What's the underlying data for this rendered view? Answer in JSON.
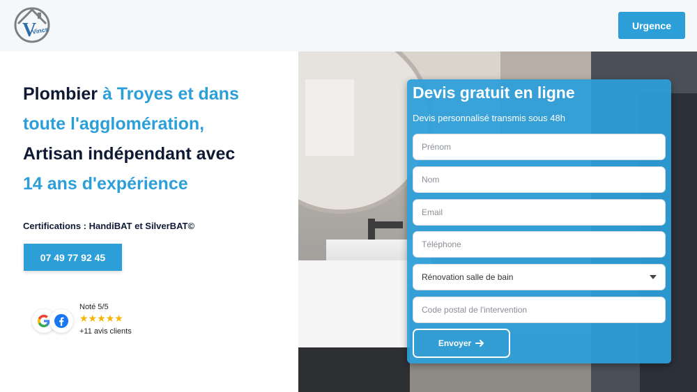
{
  "header": {
    "logo_text": "Vincs",
    "urgence_label": "Urgence"
  },
  "hero_text": {
    "line1_dark": "Plombier",
    "line1_blue": "à Troyes et dans",
    "line2_blue": "toute l'agglomération,",
    "line3_dark": "Artisan indépendant avec",
    "line4_blue": "14 ans d'expérience"
  },
  "certifications": "Certifications : HandiBAT et SilverBAT©",
  "phone_label": "07 49 77 92 45",
  "rating": {
    "title": "Noté 5/5",
    "stars": "★★★★★",
    "reviews": "+11 avis clients"
  },
  "form": {
    "title": "Devis gratuit en ligne",
    "subtitle": "Devis personnalisé transmis sous 48h",
    "fields": {
      "prenom": "Prénom",
      "nom": "Nom",
      "email": "Email",
      "telephone": "Téléphone",
      "service": "Rénovation salle de bain",
      "postal": "Code postal de l'intervention"
    },
    "submit_label": "Envoyer"
  },
  "colors": {
    "accent": "#2c9fd9",
    "dark_text": "#0e1a33",
    "header_bg": "#f6f7f9",
    "star": "#f5b400"
  }
}
